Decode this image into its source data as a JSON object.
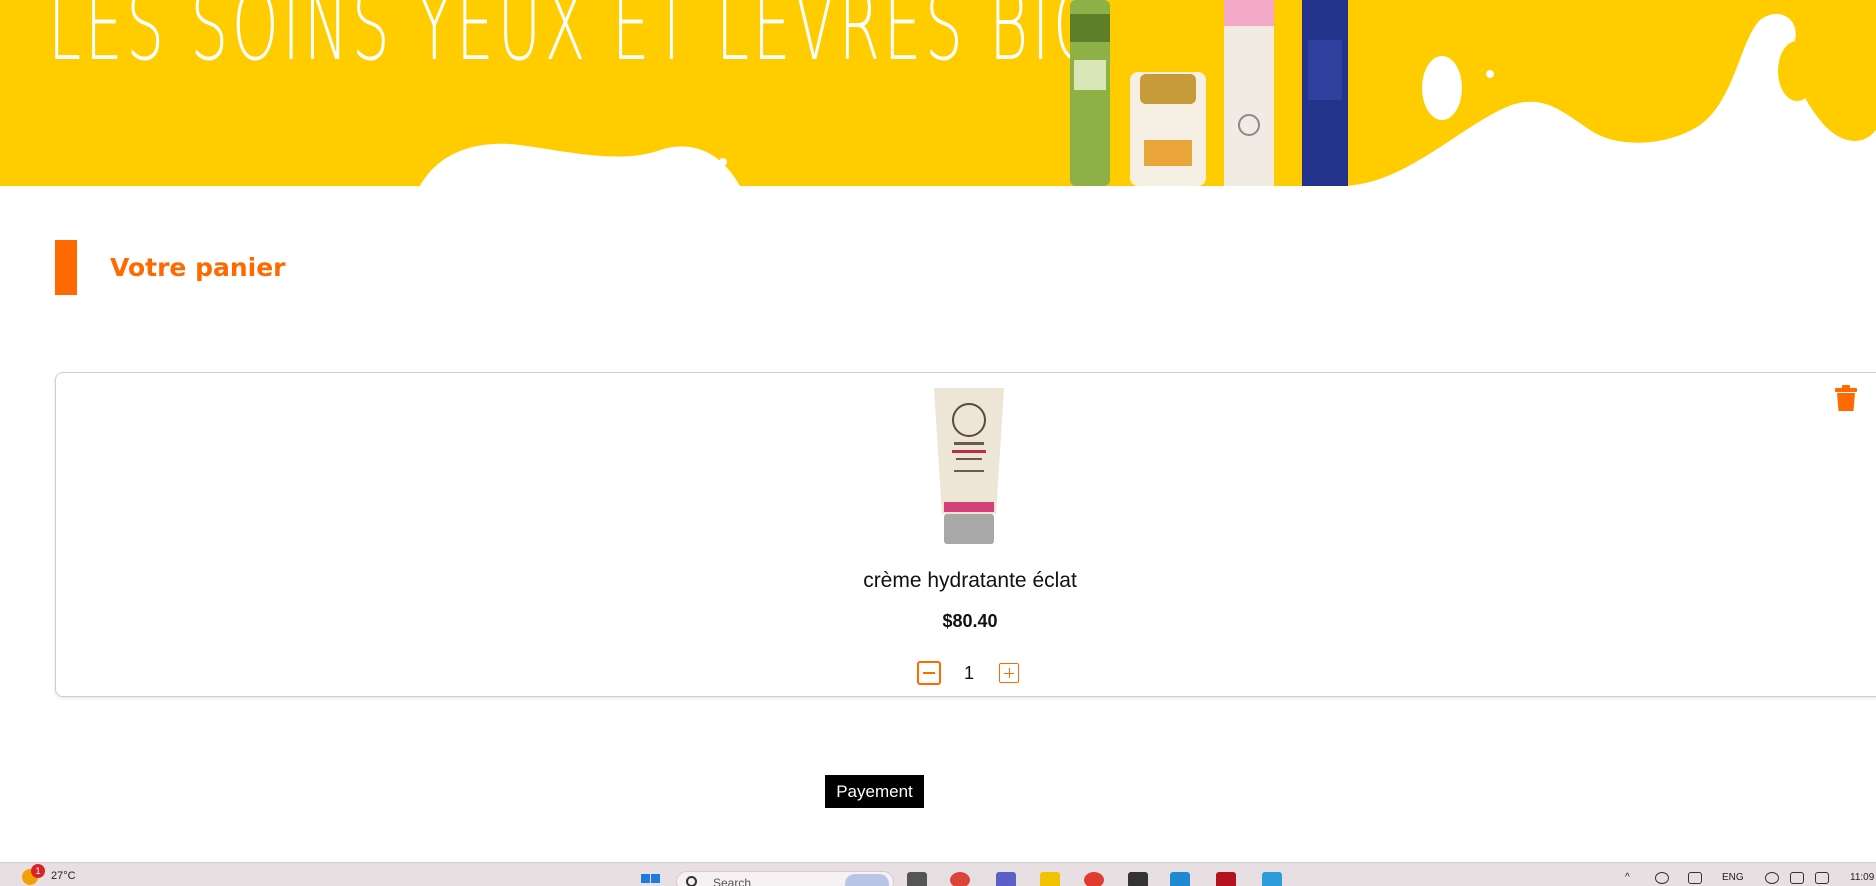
{
  "banner": {
    "title": "LES SOINS YEUX ET LEVRES BIO",
    "product_image": "banner-products"
  },
  "section": {
    "title": "Votre panier"
  },
  "cart": {
    "item": {
      "image": "product-tube-laino",
      "name": "crème hydratante éclat",
      "price": "$80.40",
      "quantity": "1"
    },
    "icons": {
      "delete": "trash-icon",
      "decrease": "minus-icon",
      "increase": "plus-icon"
    }
  },
  "actions": {
    "payment_label": "Payement"
  },
  "taskbar": {
    "weather_badge": "1",
    "temperature": "27°C",
    "search_placeholder": "Search",
    "language": "ENG",
    "clock": "11:09"
  },
  "colors": {
    "accent": "#ff6a00",
    "banner_yellow": "#ffcc00",
    "button_bg": "#000000"
  }
}
